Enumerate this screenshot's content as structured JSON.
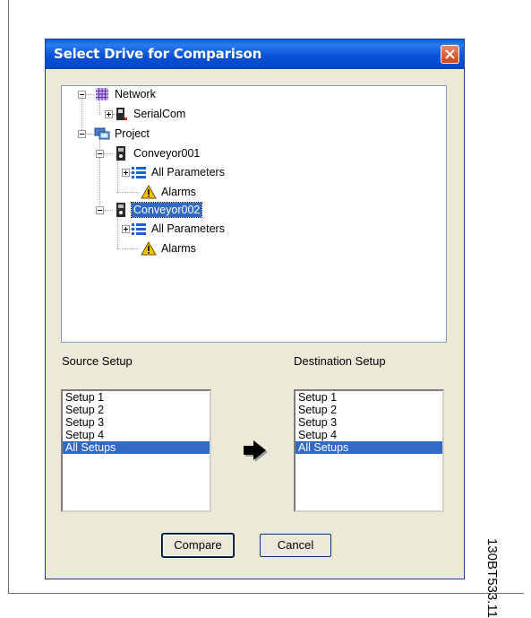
{
  "dialog": {
    "title": "Select Drive for Comparison"
  },
  "tree": {
    "network": "Network",
    "serialcom": "SerialCom",
    "project": "Project",
    "drive1": "Conveyor001",
    "drive1_params": "All Parameters",
    "drive1_alarms": "Alarms",
    "drive2": "Conveyor002",
    "drive2_params": "All Parameters",
    "drive2_alarms": "Alarms",
    "selected": "Conveyor002"
  },
  "source": {
    "label": "Source Setup",
    "items": [
      "Setup 1",
      "Setup 2",
      "Setup 3",
      "Setup 4",
      "All Setups"
    ],
    "selected": "All Setups"
  },
  "destination": {
    "label": "Destination Setup",
    "items": [
      "Setup 1",
      "Setup 2",
      "Setup 3",
      "Setup 4",
      "All Setups"
    ],
    "selected": "All Setups"
  },
  "buttons": {
    "compare": "Compare",
    "cancel": "Cancel"
  },
  "figure_id": "130BT533.11",
  "colors": {
    "title_bar": "#0a5fe0",
    "selection": "#316ac5",
    "close_button": "#d1431a"
  }
}
